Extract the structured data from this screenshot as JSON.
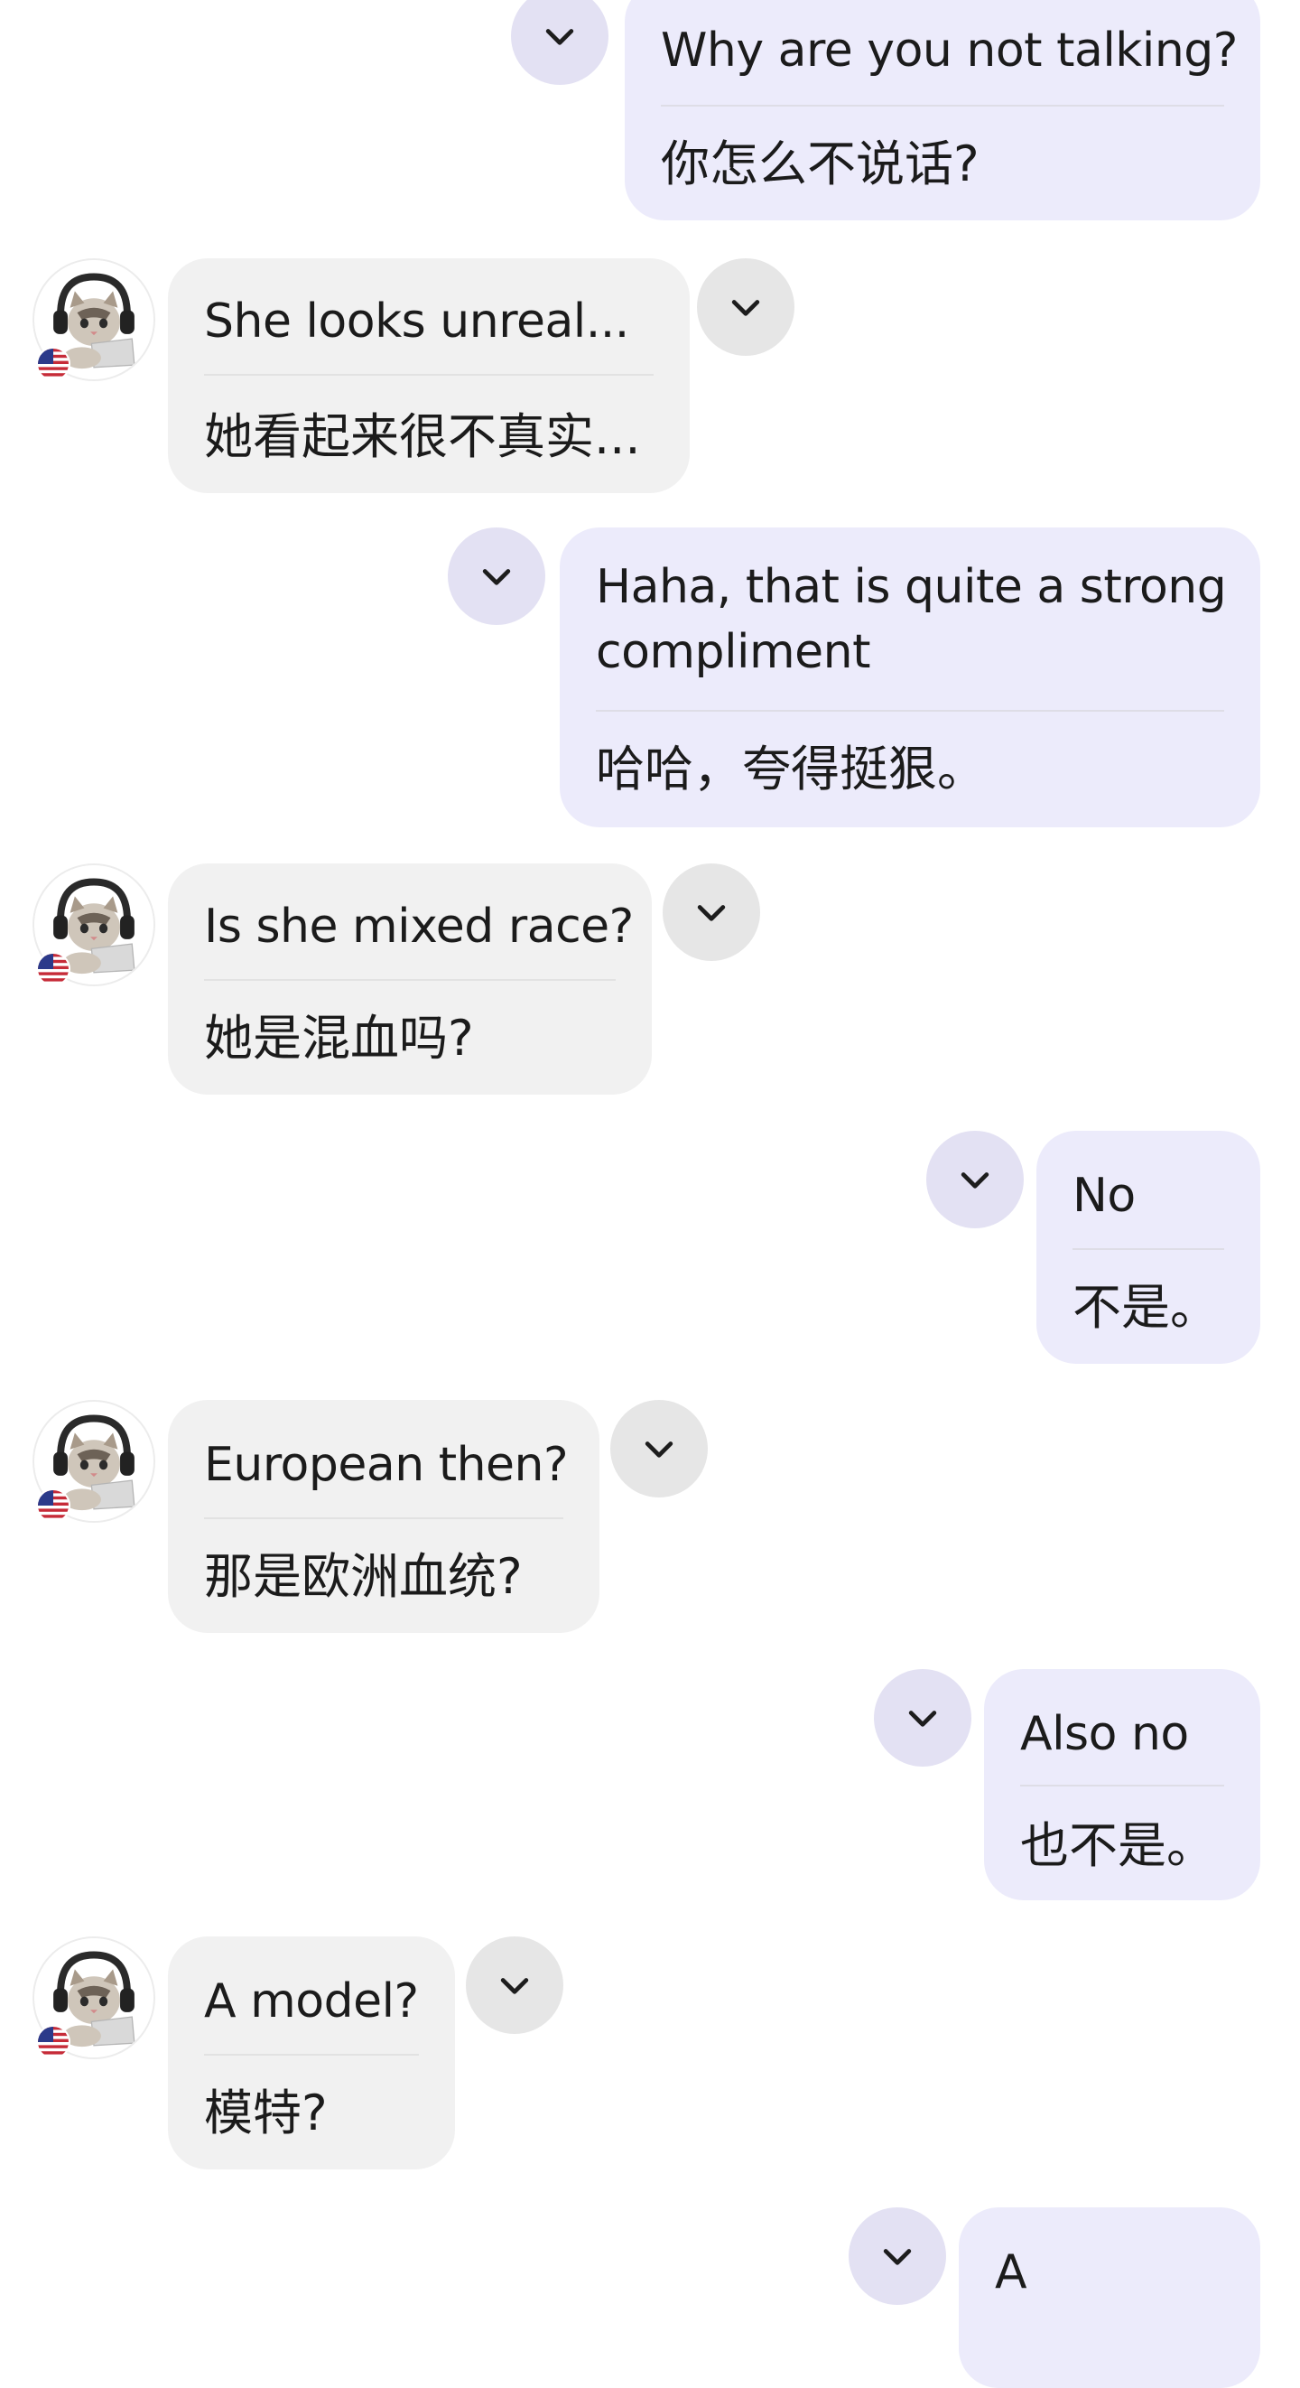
{
  "colors": {
    "outgoing_bubble": "#ecebfb",
    "incoming_bubble": "#f1f1f1",
    "outgoing_chevron_bg": "#e3e1f3",
    "incoming_chevron_bg": "#e6e6e6",
    "text": "#1b1b1b"
  },
  "messages": [
    {
      "direction": "outgoing",
      "text": "Why are you not talking?",
      "translation": "你怎么不说话?"
    },
    {
      "direction": "incoming",
      "text": "She looks unreal...",
      "translation": "她看起来很不真实..."
    },
    {
      "direction": "outgoing",
      "text_line1": "Haha, that is quite a strong",
      "text_line2": "compliment",
      "translation": "哈哈，夸得挺狠。"
    },
    {
      "direction": "incoming",
      "text": "Is she mixed race?",
      "translation": "她是混血吗?"
    },
    {
      "direction": "outgoing",
      "text": "No",
      "translation": "不是。"
    },
    {
      "direction": "incoming",
      "text": "European then?",
      "translation": "那是欧洲血统?"
    },
    {
      "direction": "outgoing",
      "text": "Also no",
      "translation": "也不是。"
    },
    {
      "direction": "incoming",
      "text": "A model?",
      "translation": "模特?"
    },
    {
      "direction": "outgoing",
      "text": "A",
      "translation": ""
    }
  ],
  "icons": {
    "expand": "chevron-down-icon",
    "avatar": "cat-with-headphones-avatar",
    "flag": "us-flag-icon"
  }
}
